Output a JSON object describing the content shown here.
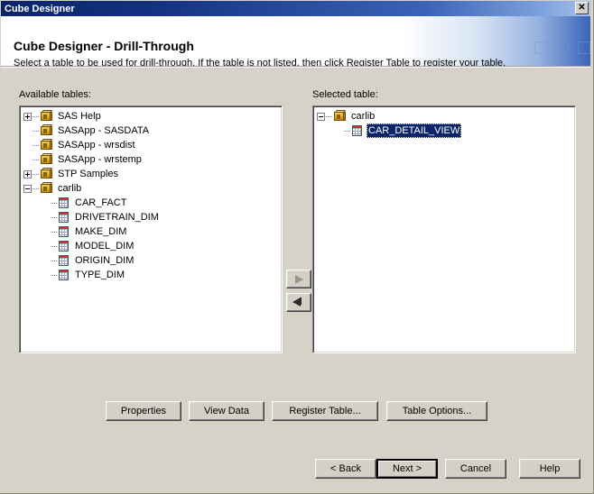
{
  "window": {
    "title": "Cube Designer",
    "close_label": "✕"
  },
  "header": {
    "title": "Cube Designer - Drill-Through",
    "subtitle": "Select a table to be used for drill-through. If the table is not listed, then click Register Table to register your table."
  },
  "left_panel": {
    "label": "Available tables:",
    "nodes": [
      {
        "label": "SAS Help",
        "icon": "library-icon",
        "level": 0,
        "expander": "plus",
        "selected": false
      },
      {
        "label": "SASApp - SASDATA",
        "icon": "library-icon",
        "level": 0,
        "expander": "none",
        "selected": false
      },
      {
        "label": "SASApp - wrsdist",
        "icon": "library-icon",
        "level": 0,
        "expander": "none",
        "selected": false
      },
      {
        "label": "SASApp - wrstemp",
        "icon": "library-icon",
        "level": 0,
        "expander": "none",
        "selected": false
      },
      {
        "label": "STP Samples",
        "icon": "library-icon",
        "level": 0,
        "expander": "plus",
        "selected": false
      },
      {
        "label": "carlib",
        "icon": "library-icon",
        "level": 0,
        "expander": "minus",
        "selected": false
      },
      {
        "label": "CAR_FACT",
        "icon": "table-icon",
        "level": 1,
        "expander": "none",
        "selected": false
      },
      {
        "label": "DRIVETRAIN_DIM",
        "icon": "table-icon",
        "level": 1,
        "expander": "none",
        "selected": false
      },
      {
        "label": "MAKE_DIM",
        "icon": "table-icon",
        "level": 1,
        "expander": "none",
        "selected": false
      },
      {
        "label": "MODEL_DIM",
        "icon": "table-icon",
        "level": 1,
        "expander": "none",
        "selected": false
      },
      {
        "label": "ORIGIN_DIM",
        "icon": "table-icon",
        "level": 1,
        "expander": "none",
        "selected": false
      },
      {
        "label": "TYPE_DIM",
        "icon": "table-icon",
        "level": 1,
        "expander": "none",
        "selected": false
      }
    ]
  },
  "right_panel": {
    "label": "Selected table:",
    "nodes": [
      {
        "label": "carlib",
        "icon": "library-icon",
        "level": 0,
        "expander": "minus",
        "selected": false
      },
      {
        "label": "CAR_DETAIL_VIEW",
        "icon": "table-icon",
        "level": 1,
        "expander": "none",
        "selected": true
      }
    ]
  },
  "transfer": {
    "add_icon": "arrow-right-icon",
    "remove_icon": "arrow-left-icon"
  },
  "table_actions": {
    "properties": "Properties",
    "view_data": "View Data",
    "register_table": "Register Table...",
    "table_options": "Table Options..."
  },
  "wizard_actions": {
    "back": "< Back",
    "next": "Next >",
    "cancel": "Cancel",
    "help": "Help"
  },
  "colors": {
    "titlebar_start": "#0a246a",
    "titlebar_end": "#a8c2e8",
    "dialog_face": "#d6d2c8",
    "selection": "#0a246a",
    "selection_text": "#ffffff"
  }
}
